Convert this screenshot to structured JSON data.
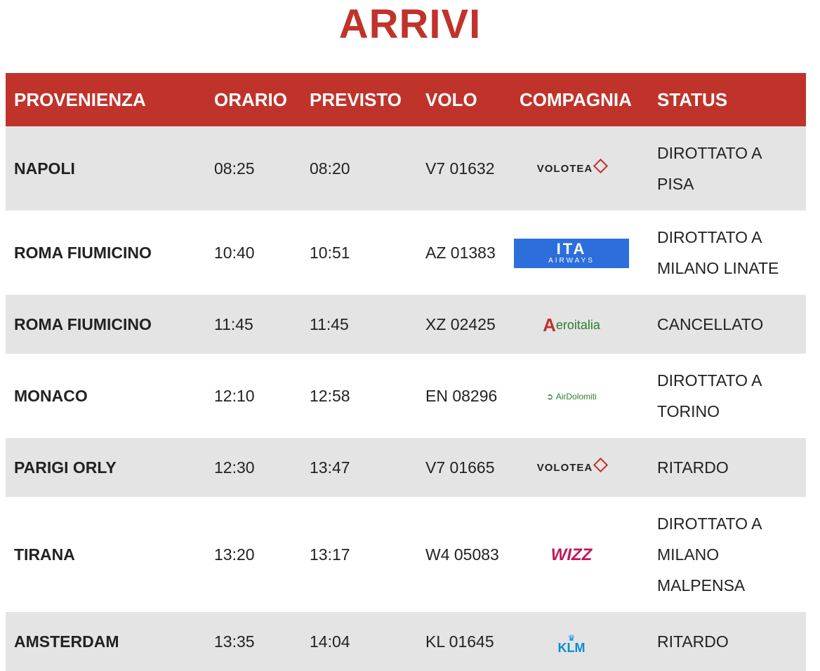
{
  "page_title": "ARRIVI",
  "table": {
    "headers": [
      "PROVENIENZA",
      "ORARIO",
      "PREVISTO",
      "VOLO",
      "COMPAGNIA",
      "STATUS"
    ],
    "rows": [
      {
        "origin": "NAPOLI",
        "scheduled": "08:25",
        "expected": "08:20",
        "flight": "V7 01632",
        "airline": "VOLOTEA",
        "status": [
          "DIROTTATO A",
          "PISA"
        ]
      },
      {
        "origin": "ROMA FIUMICINO",
        "scheduled": "10:40",
        "expected": "10:51",
        "flight": "AZ 01383",
        "airline": "ITA AIRWAYS",
        "status": [
          "DIROTTATO A",
          "MILANO LINATE"
        ]
      },
      {
        "origin": "ROMA FIUMICINO",
        "scheduled": "11:45",
        "expected": "11:45",
        "flight": "XZ 02425",
        "airline": "Aeroitalia",
        "status": [
          "CANCELLATO"
        ]
      },
      {
        "origin": "MONACO",
        "scheduled": "12:10",
        "expected": "12:58",
        "flight": "EN 08296",
        "airline": "AirDolomiti",
        "status": [
          "DIROTTATO A",
          "TORINO"
        ]
      },
      {
        "origin": "PARIGI ORLY",
        "scheduled": "12:30",
        "expected": "13:47",
        "flight": "V7 01665",
        "airline": "VOLOTEA",
        "status": [
          "RITARDO"
        ]
      },
      {
        "origin": "TIRANA",
        "scheduled": "13:20",
        "expected": "13:17",
        "flight": "W4 05083",
        "airline": "WIZZ",
        "status": [
          "DIROTTATO A",
          "MILANO",
          "MALPENSA"
        ]
      },
      {
        "origin": "AMSTERDAM",
        "scheduled": "13:35",
        "expected": "14:04",
        "flight": "KL 01645",
        "airline": "KLM",
        "status": [
          "RITARDO"
        ]
      }
    ]
  },
  "logos": {
    "volotea": "VOLOTEA",
    "ita_big": "ITA",
    "ita_small": "AIRWAYS",
    "aero_a": "A",
    "aero_rest": "eroitalia",
    "dolomiti": "AirDolomiti",
    "wizz": "WIZZ",
    "klm": "KLM",
    "klm_crown": "♛"
  },
  "colors": {
    "accent": "#c0332b",
    "row_alt": "#e4e4e4",
    "ita_blue": "#2c6fdc"
  }
}
